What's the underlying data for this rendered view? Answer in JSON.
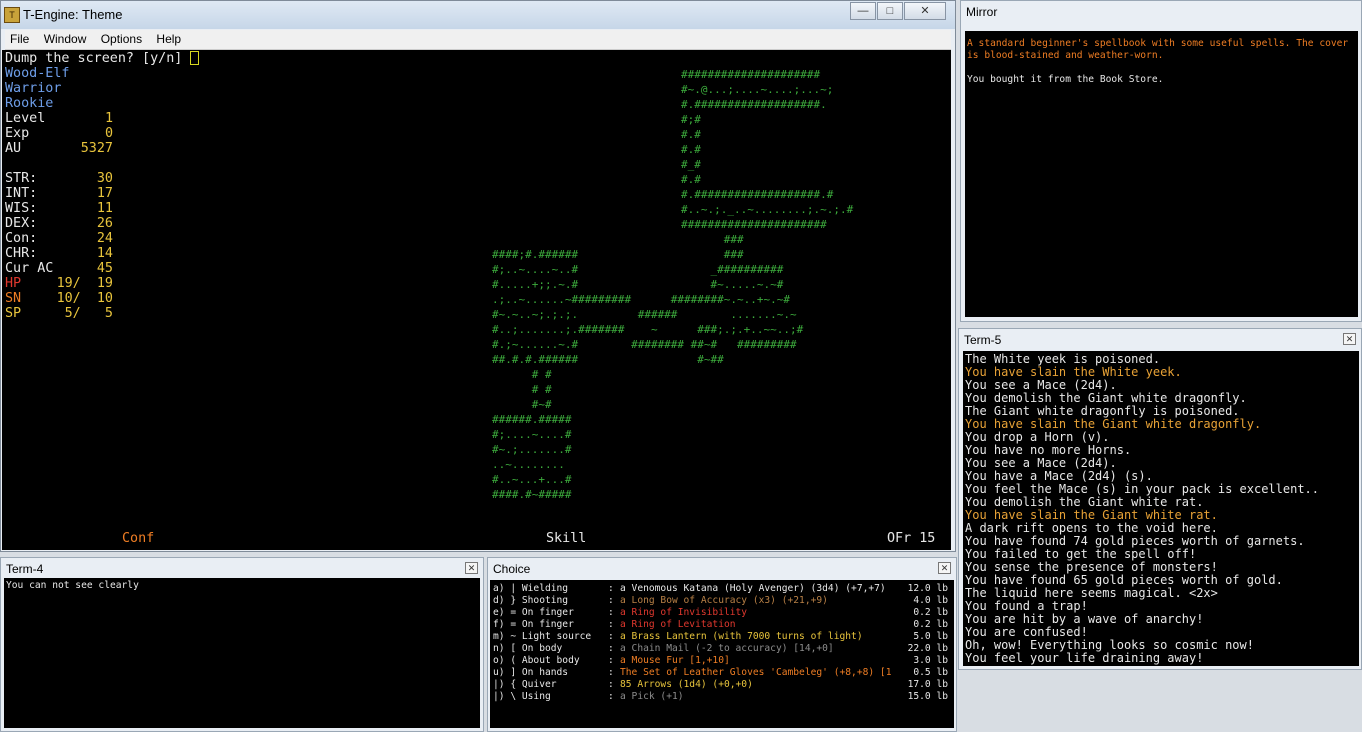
{
  "colors": {
    "green": "#3cab3c",
    "blue": "#6e9ee9",
    "white": "#e8e8e8",
    "yellow": "#e8c43c",
    "red": "#e0382e",
    "orange": "#ee7d24",
    "gold": "#e8a236",
    "brown": "#b88046",
    "grey": "#8c8c8c"
  },
  "main": {
    "title": "T-Engine: Theme",
    "menu": [
      "File",
      "Window",
      "Options",
      "Help"
    ],
    "prompt": "Dump the screen? [y/n]",
    "status": {
      "conf": "Conf",
      "skill": "Skill",
      "ofr": "OFr 15"
    }
  },
  "char": [
    {
      "label": "Wood-Elf",
      "value": "",
      "lc": "blue",
      "vc": "yellow"
    },
    {
      "label": "Warrior",
      "value": "",
      "lc": "blue",
      "vc": "yellow"
    },
    {
      "label": "Rookie",
      "value": "",
      "lc": "blue",
      "vc": "yellow"
    },
    {
      "label": "Level",
      "value": "1",
      "lc": "white",
      "vc": "yellow"
    },
    {
      "label": "Exp",
      "value": "0",
      "lc": "white",
      "vc": "yellow"
    },
    {
      "label": "AU",
      "value": "5327",
      "lc": "white",
      "vc": "yellow"
    },
    {
      "label": "",
      "value": "",
      "lc": "white",
      "vc": "yellow"
    },
    {
      "label": "STR:",
      "value": "30",
      "lc": "white",
      "vc": "yellow"
    },
    {
      "label": "INT:",
      "value": "17",
      "lc": "white",
      "vc": "yellow"
    },
    {
      "label": "WIS:",
      "value": "11",
      "lc": "white",
      "vc": "yellow"
    },
    {
      "label": "DEX:",
      "value": "26",
      "lc": "white",
      "vc": "yellow"
    },
    {
      "label": "Con:",
      "value": "24",
      "lc": "white",
      "vc": "yellow"
    },
    {
      "label": "CHR:",
      "value": "14",
      "lc": "white",
      "vc": "yellow"
    },
    {
      "label": "Cur AC",
      "value": "45",
      "lc": "white",
      "vc": "yellow"
    },
    {
      "label": "HP",
      "value": "19/  19",
      "lc": "red",
      "vc": "yellow"
    },
    {
      "label": "SN",
      "value": "10/  10",
      "lc": "orange",
      "vc": "yellow"
    },
    {
      "label": "SP",
      "value": "5/   5",
      "lc": "yellow",
      "vc": "yellow"
    }
  ],
  "map_top": [
    "#####################",
    "#~.@...;....~....;...~;",
    "#.###################.",
    "#;#",
    "#.#",
    "#.#",
    "#_#",
    "#.#",
    "#.###################.#",
    "#..~.;._..~........;.~.;.#",
    "######################"
  ],
  "map_mid": [
    "                                   ###",
    "####;#.######                      ###",
    "#;..~....~..#                    _##########",
    "#.....+;;.~.#                    #~.....~.~#",
    ".;..~......~#########      ########~.~..+~.~#",
    "#~.~..~;.;.;.         ######        .......~.~",
    "#..;.......;.#######    ~      ###;.;.+..~~..;#",
    "#.;~......~.#        ######## ##~#   #########",
    "##.#.#.######                  #~##",
    "      # #",
    "      # #",
    "      #~#",
    "######.#####",
    "#;....~....#",
    "#~.;.......#",
    "..~........",
    "#..~...+...#",
    "####.#~#####"
  ],
  "mirror": {
    "title": "Mirror",
    "desc": "A standard beginner's spellbook with some useful spells. The cover is blood-stained and weather-worn.",
    "note": "You bought it from the Book Store."
  },
  "term5": {
    "title": "Term-5",
    "lines": [
      {
        "t": "The White yeek is poisoned.",
        "c": "white"
      },
      {
        "t": "You have slain the White yeek.",
        "c": "gold"
      },
      {
        "t": "You see a Mace (2d4).",
        "c": "white"
      },
      {
        "t": "You demolish the Giant white dragonfly.",
        "c": "white"
      },
      {
        "t": "The Giant white dragonfly is poisoned.",
        "c": "white"
      },
      {
        "t": "You have slain the Giant white dragonfly.",
        "c": "gold"
      },
      {
        "t": "You drop a Horn (v).",
        "c": "white"
      },
      {
        "t": "You have no more Horns.",
        "c": "white"
      },
      {
        "t": "You see a Mace (2d4).",
        "c": "white"
      },
      {
        "t": "You have a Mace (2d4) (s).",
        "c": "white"
      },
      {
        "t": "You feel the Mace (s) in your pack is excellent..",
        "c": "white"
      },
      {
        "t": "You demolish the Giant white rat.",
        "c": "white"
      },
      {
        "t": "You have slain the Giant white rat.",
        "c": "gold"
      },
      {
        "t": "A dark rift opens to the void here.",
        "c": "white"
      },
      {
        "t": "You have found 74 gold pieces worth of garnets.",
        "c": "white"
      },
      {
        "t": "You failed to get the spell off!",
        "c": "white"
      },
      {
        "t": "You sense the presence of monsters!",
        "c": "white"
      },
      {
        "t": "You have found 65 gold pieces worth of gold.",
        "c": "white"
      },
      {
        "t": "The liquid here seems magical. <2x>",
        "c": "white"
      },
      {
        "t": "You found a trap!",
        "c": "white"
      },
      {
        "t": "You are hit by a wave of anarchy!",
        "c": "white"
      },
      {
        "t": "You are confused!",
        "c": "white"
      },
      {
        "t": "Oh, wow! Everything looks so cosmic now!",
        "c": "white"
      },
      {
        "t": "You feel your life draining away!",
        "c": "white"
      }
    ]
  },
  "term4": {
    "title": "Term-4",
    "line": "You can not see clearly"
  },
  "choice": {
    "title": "Choice",
    "rows": [
      {
        "slot": "a) | Wielding",
        "item": "a Venomous Katana (Holy Avenger) (3d4) (+7,+7)",
        "wt": "12.0 lb",
        "c": "white"
      },
      {
        "slot": "d) } Shooting",
        "item": "a Long Bow of Accuracy (x3) (+21,+9)",
        "wt": "4.0 lb",
        "c": "brown"
      },
      {
        "slot": "e) = On finger",
        "item": "a Ring of Invisibility",
        "wt": "0.2 lb",
        "c": "red"
      },
      {
        "slot": "f) = On finger",
        "item": "a Ring of Levitation",
        "wt": "0.2 lb",
        "c": "red"
      },
      {
        "slot": "m) ~ Light source",
        "item": "a Brass Lantern (with 7000 turns of light)",
        "wt": "5.0 lb",
        "c": "yellow"
      },
      {
        "slot": "n) [ On body",
        "item": "a Chain Mail (-2 to accuracy) [14,+0]",
        "wt": "22.0 lb",
        "c": "grey"
      },
      {
        "slot": "o) ( About body",
        "item": "a Mouse Fur [1,+10]",
        "wt": "3.0 lb",
        "c": "orange"
      },
      {
        "slot": "u) ] On hands",
        "item": "The Set of Leather Gloves 'Cambeleg' (+8,+8) [1",
        "wt": "0.5 lb",
        "c": "orange"
      },
      {
        "slot": "|) { Quiver",
        "item": "85 Arrows (1d4) (+0,+0)",
        "wt": "17.0 lb",
        "c": "yellow"
      },
      {
        "slot": "|) \\ Using",
        "item": "a Pick (+1)",
        "wt": "15.0 lb",
        "c": "grey"
      }
    ]
  }
}
